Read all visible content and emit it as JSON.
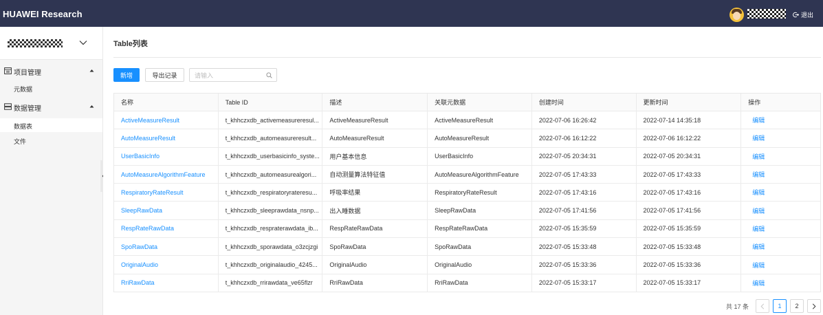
{
  "header": {
    "brand": "HUAWEI Research",
    "logout_label": "退出"
  },
  "sidebar": {
    "groups": [
      {
        "label": "项目管理",
        "icon": "calendar-icon",
        "items": [
          {
            "label": "元数据",
            "active": false
          }
        ]
      },
      {
        "label": "数据管理",
        "icon": "database-icon",
        "items": [
          {
            "label": "数据表",
            "active": true
          },
          {
            "label": "文件",
            "active": false
          }
        ]
      }
    ]
  },
  "main": {
    "title": "Table列表",
    "toolbar": {
      "add_label": "新增",
      "export_label": "导出记录",
      "search_placeholder": "请输入",
      "search_value": ""
    },
    "table": {
      "columns": [
        "名称",
        "Table ID",
        "描述",
        "关联元数据",
        "创建时间",
        "更新时间",
        "操作"
      ],
      "rows": [
        {
          "name": "ActiveMeasureResult",
          "table_id": "t_khhczxdb_activemeasureresul...",
          "desc": "ActiveMeasureResult",
          "meta": "ActiveMeasureResult",
          "created": "2022-07-06 16:26:42",
          "updated": "2022-07-14 14:35:18",
          "action": "编辑"
        },
        {
          "name": "AutoMeasureResult",
          "table_id": "t_khhczxdb_automeasureresult...",
          "desc": "AutoMeasureResult",
          "meta": "AutoMeasureResult",
          "created": "2022-07-06 16:12:22",
          "updated": "2022-07-06 16:12:22",
          "action": "编辑"
        },
        {
          "name": "UserBasicInfo",
          "table_id": "t_khhczxdb_userbasicinfo_syste...",
          "desc": "用户基本信息",
          "meta": "UserBasicInfo",
          "created": "2022-07-05 20:34:31",
          "updated": "2022-07-05 20:34:31",
          "action": "编辑"
        },
        {
          "name": "AutoMeasureAlgorithmFeature",
          "table_id": "t_khhczxdb_automeasurealgori...",
          "desc": "自动测量算法特征值",
          "meta": "AutoMeasureAlgorithmFeature",
          "created": "2022-07-05 17:43:33",
          "updated": "2022-07-05 17:43:33",
          "action": "编辑"
        },
        {
          "name": "RespiratoryRateResult",
          "table_id": "t_khhczxdb_respiratoryrateresu...",
          "desc": "呼吸率结果",
          "meta": "RespiratoryRateResult",
          "created": "2022-07-05 17:43:16",
          "updated": "2022-07-05 17:43:16",
          "action": "编辑"
        },
        {
          "name": "SleepRawData",
          "table_id": "t_khhczxdb_sleeprawdata_nsnp...",
          "desc": "出入睡数据",
          "meta": "SleepRawData",
          "created": "2022-07-05 17:41:56",
          "updated": "2022-07-05 17:41:56",
          "action": "编辑"
        },
        {
          "name": "RespRateRawData",
          "table_id": "t_khhczxdb_respraterawdata_ib...",
          "desc": "RespRateRawData",
          "meta": "RespRateRawData",
          "created": "2022-07-05 15:35:59",
          "updated": "2022-07-05 15:35:59",
          "action": "编辑"
        },
        {
          "name": "SpoRawData",
          "table_id": "t_khhczxdb_sporawdata_o3zcjzgi",
          "desc": "SpoRawData",
          "meta": "SpoRawData",
          "created": "2022-07-05 15:33:48",
          "updated": "2022-07-05 15:33:48",
          "action": "编辑"
        },
        {
          "name": "OriginalAudio",
          "table_id": "t_khhczxdb_originalaudio_4245...",
          "desc": "OriginalAudio",
          "meta": "OriginalAudio",
          "created": "2022-07-05 15:33:36",
          "updated": "2022-07-05 15:33:36",
          "action": "编辑"
        },
        {
          "name": "RriRawData",
          "table_id": "t_khhczxdb_rrirawdata_ve65flzr",
          "desc": "RriRawData",
          "meta": "RriRawData",
          "created": "2022-07-05 15:33:17",
          "updated": "2022-07-05 15:33:17",
          "action": "编辑"
        }
      ]
    },
    "pagination": {
      "total_text": "共 17 条",
      "pages": [
        "1",
        "2"
      ],
      "current": "1"
    }
  },
  "colors": {
    "topbar": "#2f3552",
    "primary": "#1890ff",
    "sidebar_bg": "#f5f5f5"
  }
}
